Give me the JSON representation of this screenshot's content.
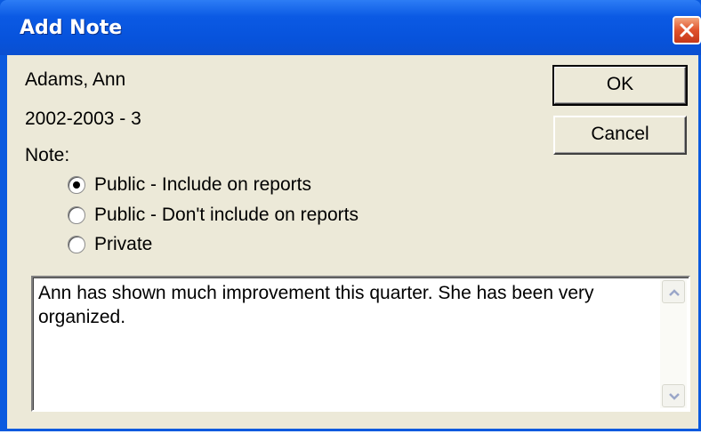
{
  "window": {
    "title": "Add Note",
    "close_icon": "close-x-icon"
  },
  "student_name": "Adams, Ann",
  "term": "2002-2003 - 3",
  "note_label": "Note:",
  "visibility_options": [
    {
      "label": "Public - Include on reports",
      "selected": true
    },
    {
      "label": "Public - Don't include on reports",
      "selected": false
    },
    {
      "label": "Private",
      "selected": false
    }
  ],
  "buttons": {
    "ok": "OK",
    "cancel": "Cancel"
  },
  "note_text": "Ann has shown much improvement this quarter. She has been very organized.",
  "colors": {
    "titlebar": "#0a5adf",
    "dialog_bg": "#ece9d8",
    "close_button": "#e0522c"
  }
}
